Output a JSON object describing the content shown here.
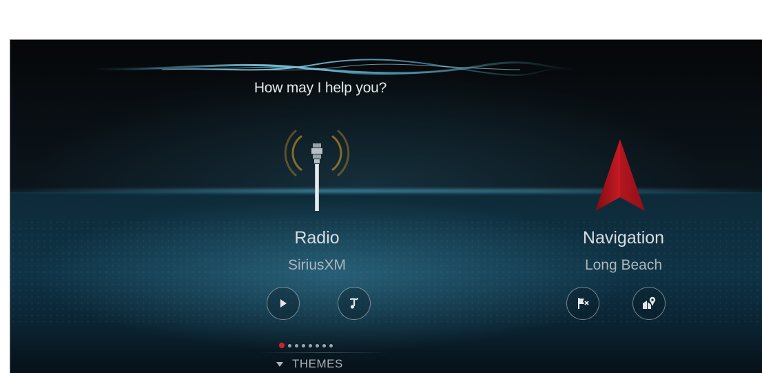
{
  "voice": {
    "prompt": "How may I help you?"
  },
  "radio": {
    "title": "Radio",
    "subtitle": "SiriusXM",
    "icon": "radio-tower-icon",
    "buttons": [
      {
        "icon": "play-icon"
      },
      {
        "icon": "tune-icon"
      }
    ]
  },
  "navigation": {
    "title": "Navigation",
    "subtitle": "Long Beach",
    "icon": "navigation-arrow-icon",
    "buttons": [
      {
        "icon": "destination-flag-icon"
      },
      {
        "icon": "poi-map-icon"
      }
    ]
  },
  "pager": {
    "count": 8,
    "active_index": 0
  },
  "themes": {
    "label": "THEMES"
  },
  "colors": {
    "accent_red": "#d5202a",
    "glow_blue": "#5fb6d4",
    "amber": "#e7a826"
  }
}
